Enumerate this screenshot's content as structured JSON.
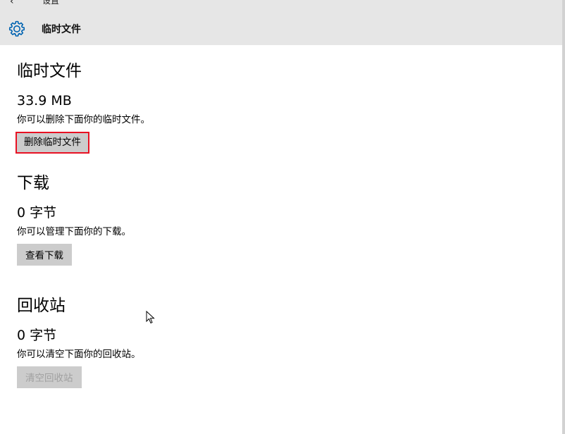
{
  "window": {
    "title": "设置",
    "back_glyph": "‹"
  },
  "header": {
    "title": "临时文件",
    "icon": "gear-icon"
  },
  "sections": [
    {
      "title": "临时文件",
      "size": "33.9 MB",
      "description": "你可以删除下面你的临时文件。",
      "button_label": "删除临时文件",
      "button_state": "focused"
    },
    {
      "title": "下载",
      "size": "0 字节",
      "description": "你可以管理下面你的下载。",
      "button_label": "查看下载",
      "button_state": "normal"
    },
    {
      "title": "回收站",
      "size": "0 字节",
      "description": "你可以清空下面你的回收站。",
      "button_label": "清空回收站",
      "button_state": "disabled"
    }
  ],
  "colors": {
    "header_bg": "#e6e6e6",
    "accent": "#0063b1",
    "button_bg": "#cccccc",
    "focus_border": "#e81123"
  }
}
